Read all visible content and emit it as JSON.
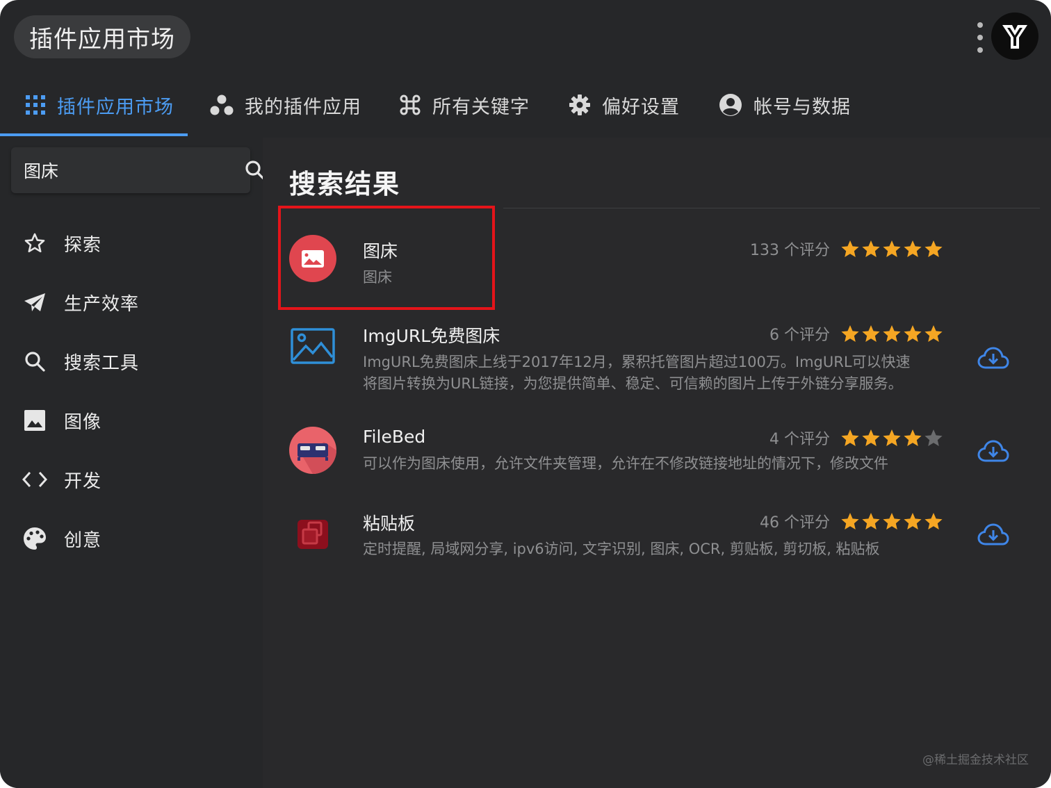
{
  "titlebar": {
    "title": "插件应用市场"
  },
  "tabs": [
    {
      "label": "插件应用市场",
      "icon": "grid-icon",
      "active": true
    },
    {
      "label": "我的插件应用",
      "icon": "circles-icon",
      "active": false
    },
    {
      "label": "所有关键字",
      "icon": "command-icon",
      "active": false
    },
    {
      "label": "偏好设置",
      "icon": "gear-icon",
      "active": false
    },
    {
      "label": "帐号与数据",
      "icon": "account-icon",
      "active": false
    }
  ],
  "search": {
    "value": "图床"
  },
  "sidebar": {
    "items": [
      {
        "label": "探索",
        "icon": "star-outline-icon"
      },
      {
        "label": "生产效率",
        "icon": "paper-plane-icon"
      },
      {
        "label": "搜索工具",
        "icon": "search-icon"
      },
      {
        "label": "图像",
        "icon": "image-icon"
      },
      {
        "label": "开发",
        "icon": "code-icon"
      },
      {
        "label": "创意",
        "icon": "palette-icon"
      }
    ]
  },
  "main": {
    "title": "搜索结果",
    "results": [
      {
        "name": "图床",
        "desc": [
          "图床"
        ],
        "rating_text": "133 个评分",
        "stars": 5,
        "installable": false,
        "icon": "picture-bed-icon"
      },
      {
        "name": "ImgURL免费图床",
        "desc": [
          "ImgURL免费图床上线于2017年12月，累积托管图片超过100万。ImgURL可以快速",
          "将图片转换为URL链接，为您提供简单、稳定、可信赖的图片上传于外链分享服务。"
        ],
        "rating_text": "6 个评分",
        "stars": 5,
        "installable": true,
        "icon": "image-frame-icon"
      },
      {
        "name": "FileBed",
        "desc": [
          "可以作为图床使用，允许文件夹管理，允许在不修改链接地址的情况下，修改文件"
        ],
        "rating_text": "4 个评分",
        "stars": 4,
        "installable": true,
        "icon": "bed-icon"
      },
      {
        "name": "粘贴板",
        "desc": [
          "定时提醒, 局域网分享, ipv6访问, 文字识别, 图床, OCR, 剪贴板, 剪切板, 粘贴板"
        ],
        "rating_text": "46 个评分",
        "stars": 5,
        "installable": true,
        "icon": "clipboard-icon"
      }
    ]
  },
  "watermark": "@稀土掘金技术社区",
  "colors": {
    "accent": "#4c9cf2",
    "star": "#f5a623",
    "highlight": "#e4141a",
    "background": "#262729"
  }
}
